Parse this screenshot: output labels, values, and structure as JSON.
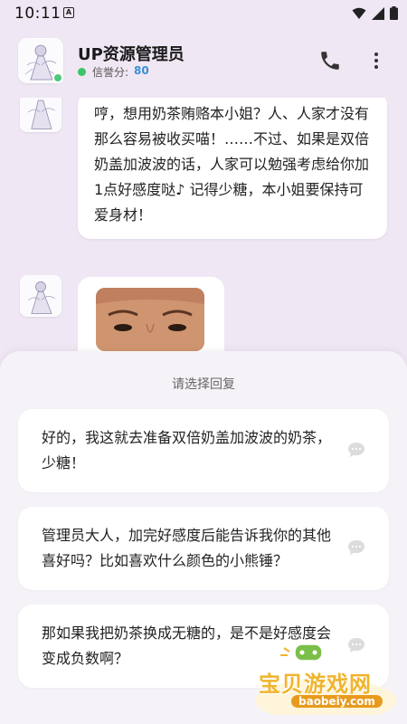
{
  "status": {
    "time": "10:11",
    "notif_icon": "A"
  },
  "header": {
    "title": "UP资源管理员",
    "reputation_label": "信誉分:",
    "reputation_value": "80",
    "online_color": "#4cc97a"
  },
  "chat": {
    "messages": [
      {
        "type": "text",
        "text": "哼，想用奶茶贿赂本小姐？人、人家才没有那么容易被收买喵！……不过、如果是双倍奶盖加波波的话，人家可以勉强考虑给你加1点好感度哒♪ 记得少糖，本小姐要保持可爱身材！"
      },
      {
        "type": "image"
      }
    ]
  },
  "reply": {
    "title": "请选择回复",
    "options": [
      "好的，我这就去准备双倍奶盖加波波的奶茶，少糖！",
      "管理员大人，加完好感度后能告诉我你的其他喜好吗？比如喜欢什么颜色的小熊锤？",
      "那如果我把奶茶换成无糖的，是不是好感度会变成负数啊？"
    ]
  },
  "watermark": {
    "text": "宝贝游戏网",
    "domain": "baobeiy.com"
  },
  "colors": {
    "background": "#efe7f3",
    "accent": "#3b8ed6",
    "watermark": "#f0b42e"
  }
}
